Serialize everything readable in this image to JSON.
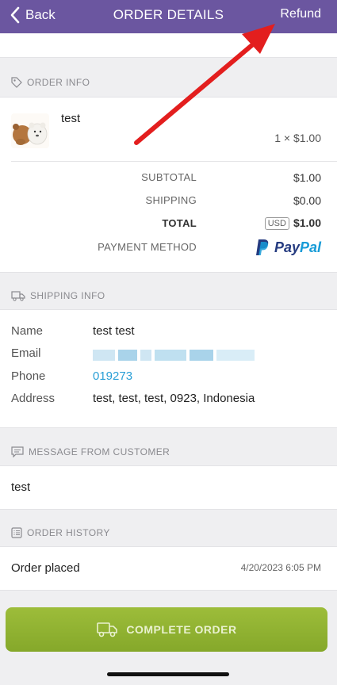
{
  "nav": {
    "back_label": "Back",
    "title": "ORDER DETAILS",
    "refund_label": "Refund"
  },
  "order_info": {
    "heading": "ORDER INFO",
    "product_name": "test",
    "product_qty_price": "1 × $1.00",
    "subtotal_label": "SUBTOTAL",
    "subtotal_value": "$1.00",
    "shipping_label": "SHIPPING",
    "shipping_value": "$0.00",
    "total_label": "TOTAL",
    "total_currency": "USD",
    "total_value": "$1.00",
    "payment_label": "PAYMENT METHOD",
    "payment_brand_pay": "Pay",
    "payment_brand_pal": "Pal"
  },
  "shipping_info": {
    "heading": "SHIPPING INFO",
    "name_label": "Name",
    "name_value": "test test",
    "email_label": "Email",
    "phone_label": "Phone",
    "phone_value": "019273",
    "address_label": "Address",
    "address_value": "test, test, test, 0923, Indonesia"
  },
  "message": {
    "heading": "MESSAGE FROM CUSTOMER",
    "text": "test"
  },
  "history": {
    "heading": "ORDER HISTORY",
    "event": "Order placed",
    "timestamp": "4/20/2023 6:05 PM"
  },
  "actions": {
    "complete_label": "COMPLETE ORDER"
  },
  "colors": {
    "navbar": "#6b56a0",
    "complete_button": "#95b634",
    "link": "#2a9fd6",
    "annotation_arrow": "#e31e1e"
  }
}
